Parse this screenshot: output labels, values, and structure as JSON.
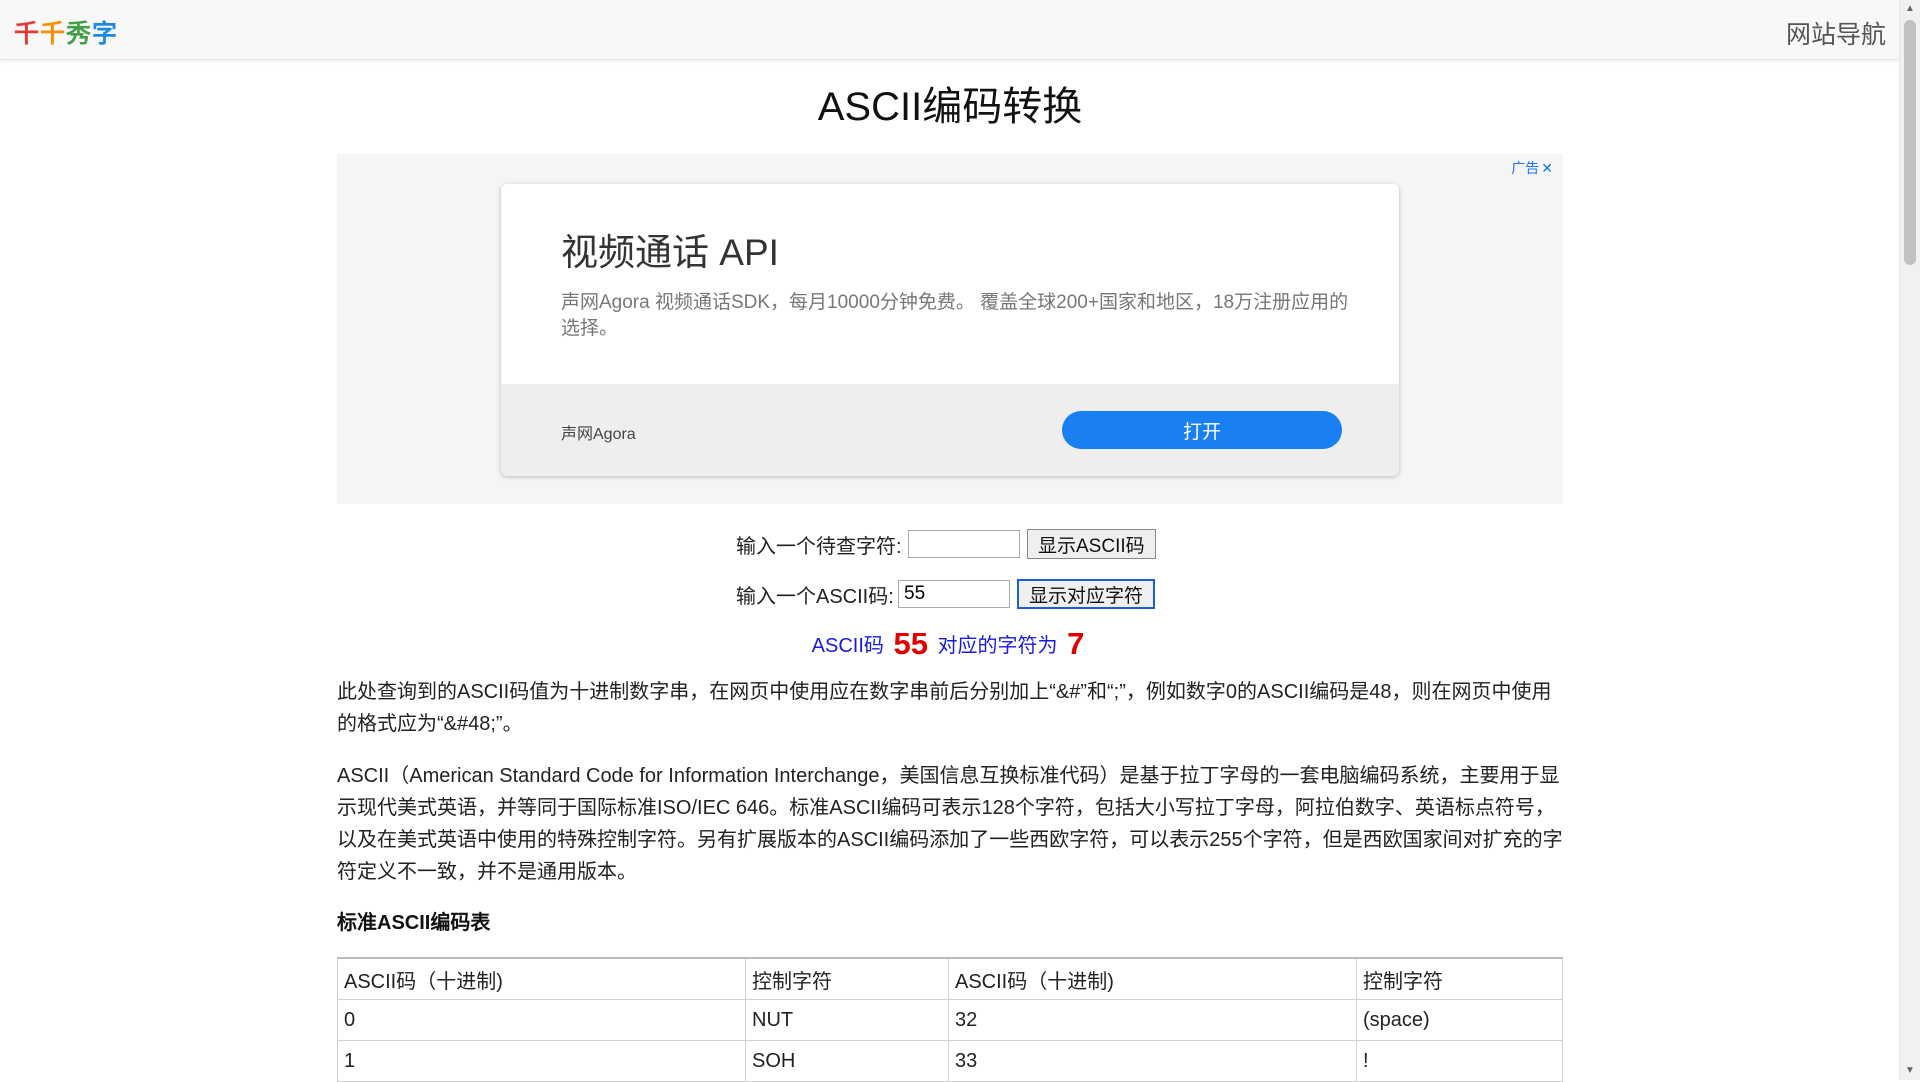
{
  "header": {
    "logo": [
      {
        "char": "千",
        "color": "#e53935"
      },
      {
        "char": "千",
        "color": "#fb8c00"
      },
      {
        "char": "秀",
        "color": "#43a047"
      },
      {
        "char": "字",
        "color": "#1e88e5"
      }
    ],
    "nav_label": "网站导航"
  },
  "page": {
    "title": "ASCII编码转换"
  },
  "ad": {
    "marker": "广告",
    "close": "✕",
    "headline": "视频通话 API",
    "description": "声网Agora 视频通话SDK，每月10000分钟免费。 覆盖全球200+国家和地区，18万注册应用的选择。",
    "brand": "声网Agora",
    "cta": "打开"
  },
  "form": {
    "char_label": "输入一个待查字符:",
    "char_value": "",
    "char_button": "显示ASCII码",
    "code_label": "输入一个ASCII码:",
    "code_value": "55",
    "code_button": "显示对应字符"
  },
  "result": {
    "prefix": "ASCII码",
    "code": "55",
    "middle": "对应的字符为",
    "char": "7"
  },
  "content": {
    "para1": "此处查询到的ASCII码值为十进制数字串，在网页中使用应在数字串前后分别加上“&#”和“;”，例如数字0的ASCII编码是48，则在网页中使用的格式应为“&#48;”。",
    "para2": "ASCII（American Standard Code for Information Interchange，美国信息互换标准代码）是基于拉丁字母的一套电脑编码系统，主要用于显示现代美式英语，并等同于国际标准ISO/IEC 646。标准ASCII编码可表示128个字符，包括大小写拉丁字母，阿拉伯数字、英语标点符号，以及在美式英语中使用的特殊控制字符。另有扩展版本的ASCII编码添加了一些西欧字符，可以表示255个字符，但是西欧国家间对扩充的字符定义不一致，并不是通用版本。",
    "table_heading": "标准ASCII编码表"
  },
  "table": {
    "headers": [
      "ASCII码（十进制)",
      "控制字符",
      "ASCII码（十进制)",
      "控制字符"
    ],
    "rows": [
      [
        "0",
        "NUT",
        "32",
        "(space)"
      ],
      [
        "1",
        "SOH",
        "33",
        "!"
      ]
    ]
  }
}
